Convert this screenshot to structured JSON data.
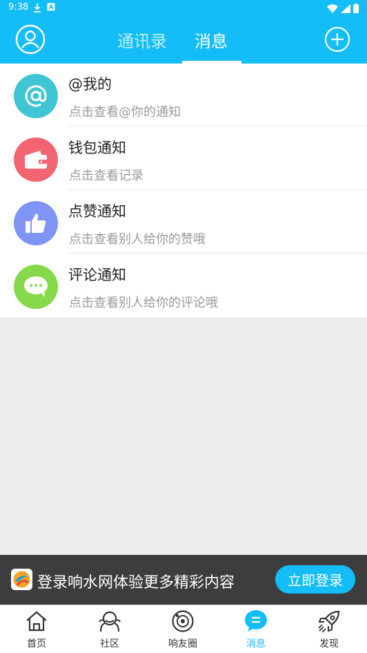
{
  "status_bar": {
    "time": "9:38"
  },
  "header": {
    "tabs": [
      {
        "label": "通讯录",
        "active": false
      },
      {
        "label": "消息",
        "active": true
      }
    ],
    "accent_color": "#15bdf8"
  },
  "messages": [
    {
      "title": "@我的",
      "subtitle": "点击查看@你的通知",
      "icon": "at-icon",
      "color": "#3fc5d4"
    },
    {
      "title": "钱包通知",
      "subtitle": "点击查看记录",
      "icon": "wallet-icon",
      "color": "#f26471"
    },
    {
      "title": "点赞通知",
      "subtitle": "点击查看别人给你的赞哦",
      "icon": "thumbs-up-icon",
      "color": "#7f94f5"
    },
    {
      "title": "评论通知",
      "subtitle": "点击查看别人给你的评论哦",
      "icon": "comment-icon",
      "color": "#86d94a"
    }
  ],
  "login_banner": {
    "text": "登录响水网体验更多精彩内容",
    "button_label": "立即登录"
  },
  "bottom_nav": [
    {
      "label": "首页",
      "icon": "home-icon",
      "active": false
    },
    {
      "label": "社区",
      "icon": "community-icon",
      "active": false
    },
    {
      "label": "响友圈",
      "icon": "friends-circle-icon",
      "active": false
    },
    {
      "label": "消息",
      "icon": "message-icon",
      "active": true
    },
    {
      "label": "发现",
      "icon": "rocket-icon",
      "active": false
    }
  ]
}
